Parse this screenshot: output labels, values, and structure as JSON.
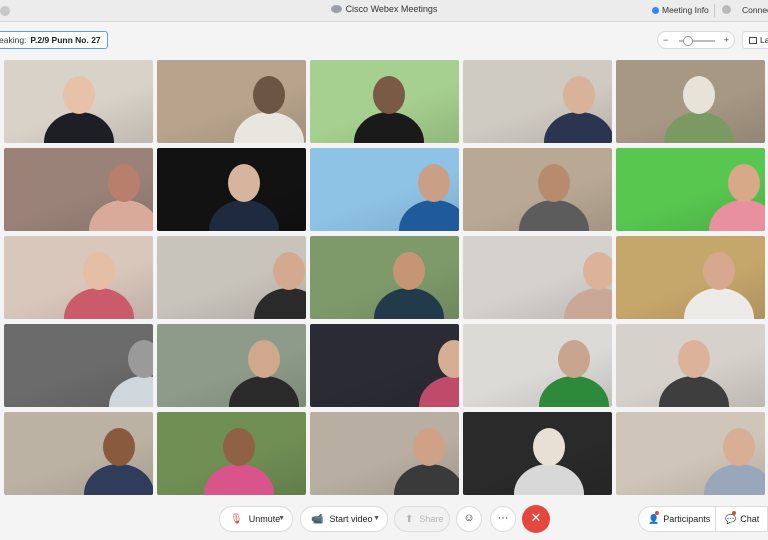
{
  "window": {
    "title": "Cisco Webex Meetings",
    "meeting_info_label": "Meeting Info",
    "connection_label": "Connec"
  },
  "speaker_bar": {
    "label": "eaking:",
    "name": "P.2/9 Punn No. 27"
  },
  "zoom": {
    "minus": "−",
    "plus": "+",
    "level": 0.1
  },
  "layout_label": "Lay",
  "participant_tiles": [
    {
      "bg": "#d9d2c8",
      "fg": "#1e1f24",
      "skin": "#e7c2a8"
    },
    {
      "bg": "#b8a48c",
      "fg": "#e9e6e0",
      "skin": "#6a5643"
    },
    {
      "bg": "#a6d08f",
      "fg": "#1a1a1a",
      "skin": "#7a5a44"
    },
    {
      "bg": "#cfcac2",
      "fg": "#2c3550",
      "skin": "#d9b29a"
    },
    {
      "bg": "#a79884",
      "fg": "#7b9a63",
      "skin": "#e8e3d8"
    },
    {
      "bg": "#9a8278",
      "fg": "#d9a99a",
      "skin": "#b87f6d"
    },
    {
      "bg": "#121212",
      "fg": "#1e2a3e",
      "skin": "#d6b49d"
    },
    {
      "bg": "#8ec3e6",
      "fg": "#1f5b9a",
      "skin": "#c99f85"
    },
    {
      "bg": "#b9a994",
      "fg": "#5c5c5c",
      "skin": "#b98b6e"
    },
    {
      "bg": "#57c74f",
      "fg": "#e88fa0",
      "skin": "#d8a889"
    },
    {
      "bg": "#d9c7bb",
      "fg": "#c95b6b",
      "skin": "#e4bea5"
    },
    {
      "bg": "#c8c3bb",
      "fg": "#2a2a2a",
      "skin": "#d3aa90"
    },
    {
      "bg": "#7e9a6a",
      "fg": "#233a4a",
      "skin": "#c79576"
    },
    {
      "bg": "#d5d2cd",
      "fg": "#c9a898",
      "skin": "#dcb29a"
    },
    {
      "bg": "#c6a76b",
      "fg": "#ecebe7",
      "skin": "#d6a98e"
    },
    {
      "bg": "#6b6b6b",
      "fg": "#cfd6dc",
      "skin": "#9a9a9a"
    },
    {
      "bg": "#8e9b8a",
      "fg": "#2a2a2a",
      "skin": "#cfa88e"
    },
    {
      "bg": "#2b2b35",
      "fg": "#c04a6a",
      "skin": "#d5ae94"
    },
    {
      "bg": "#dcdad6",
      "fg": "#2d8a3a",
      "skin": "#c7a58e"
    },
    {
      "bg": "#d6d1ca",
      "fg": "#3e3e3e",
      "skin": "#dcb39a"
    },
    {
      "bg": "#bcb2a4",
      "fg": "#2f3d5a",
      "skin": "#8a5a3f"
    },
    {
      "bg": "#6f8f54",
      "fg": "#d7558a",
      "skin": "#8f6245"
    },
    {
      "bg": "#b8aea2",
      "fg": "#3a3a3a",
      "skin": "#cfa186"
    },
    {
      "bg": "#2a2a2a",
      "fg": "#d8d8d8",
      "skin": "#e8e0d4"
    },
    {
      "bg": "#cfc5b8",
      "fg": "#9aa6b9",
      "skin": "#d8ae95"
    }
  ],
  "controls": {
    "unmute": "Unmute",
    "start_video": "Start video",
    "share": "Share",
    "participants": "Participants",
    "chat": "Chat"
  },
  "icons": {
    "mic": "🎙",
    "camera": "📹",
    "share": "⬆",
    "emoji": "☺",
    "more": "···",
    "end": "✕",
    "participants": "👤",
    "chat": "💬"
  }
}
